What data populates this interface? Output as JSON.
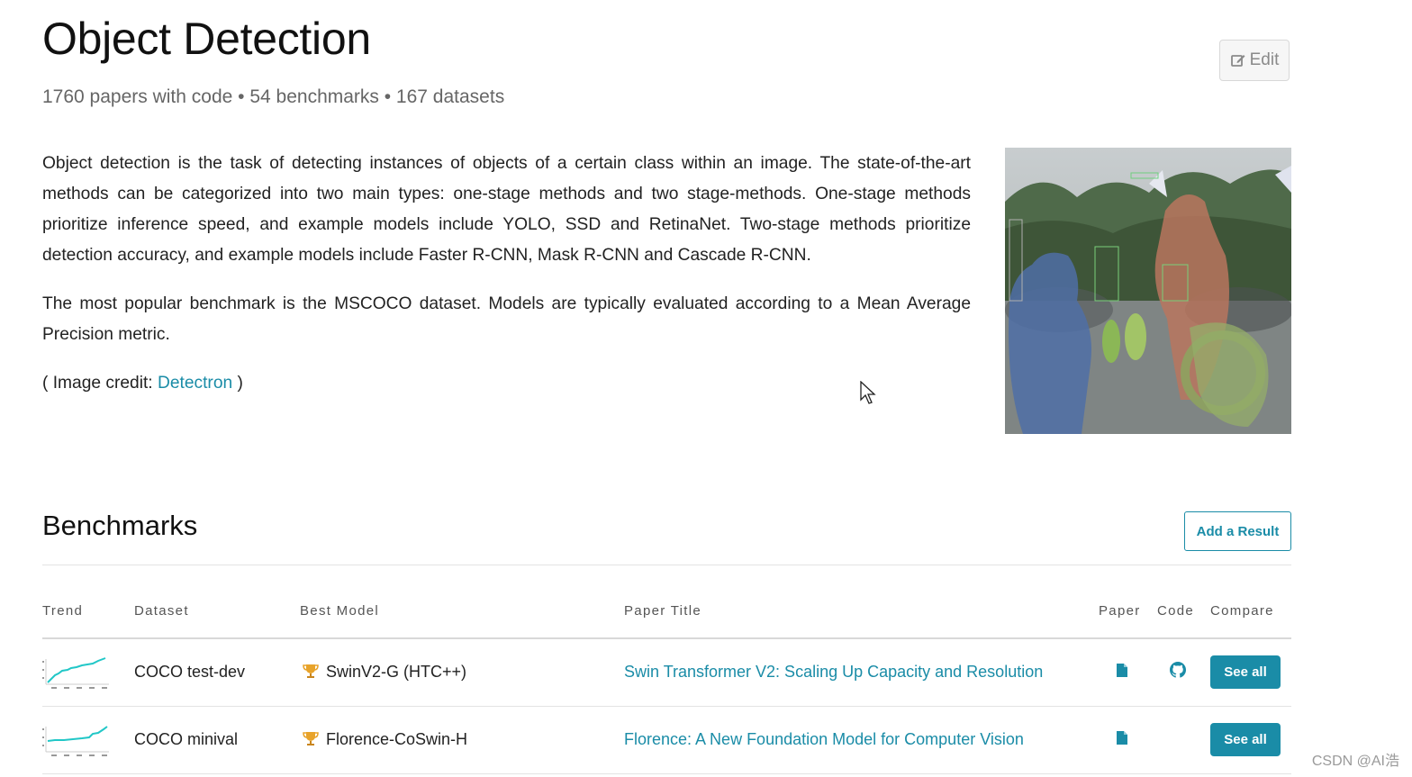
{
  "header": {
    "title": "Object Detection",
    "stats": "1760 papers with code • 54 benchmarks • 167 datasets",
    "edit_label": "Edit"
  },
  "description": {
    "paragraph1": "Object detection is the task of detecting instances of objects of a certain class within an image. The state-of-the-art methods can be categorized into two main types: one-stage methods and two stage-methods. One-stage methods prioritize inference speed, and example models include YOLO, SSD and RetinaNet. Two-stage methods prioritize detection accuracy, and example models include Faster R-CNN, Mask R-CNN and Cascade R-CNN.",
    "paragraph2": "The most popular benchmark is the MSCOCO dataset. Models are typically evaluated according to a Mean Average Precision metric.",
    "credit_prefix": "( Image credit: ",
    "credit_link": "Detectron",
    "credit_suffix": " )"
  },
  "benchmarks": {
    "title": "Benchmarks",
    "add_result_label": "Add a Result",
    "columns": {
      "trend": "Trend",
      "dataset": "Dataset",
      "best_model": "Best Model",
      "paper_title": "Paper Title",
      "paper": "Paper",
      "code": "Code",
      "compare": "Compare"
    },
    "rows": [
      {
        "dataset": "COCO test-dev",
        "best_model": "SwinV2-G (HTC++)",
        "paper_title": "Swin Transformer V2: Scaling Up Capacity and Resolution",
        "has_paper": true,
        "has_code": true,
        "compare_label": "See all"
      },
      {
        "dataset": "COCO minival",
        "best_model": "Florence-CoSwin-H",
        "paper_title": "Florence: A New Foundation Model for Computer Vision",
        "has_paper": true,
        "has_code": false,
        "compare_label": "See all"
      }
    ]
  },
  "watermark": "CSDN @AI浩",
  "colors": {
    "accent": "#1a8ca7",
    "trend_line": "#21c7c7"
  }
}
